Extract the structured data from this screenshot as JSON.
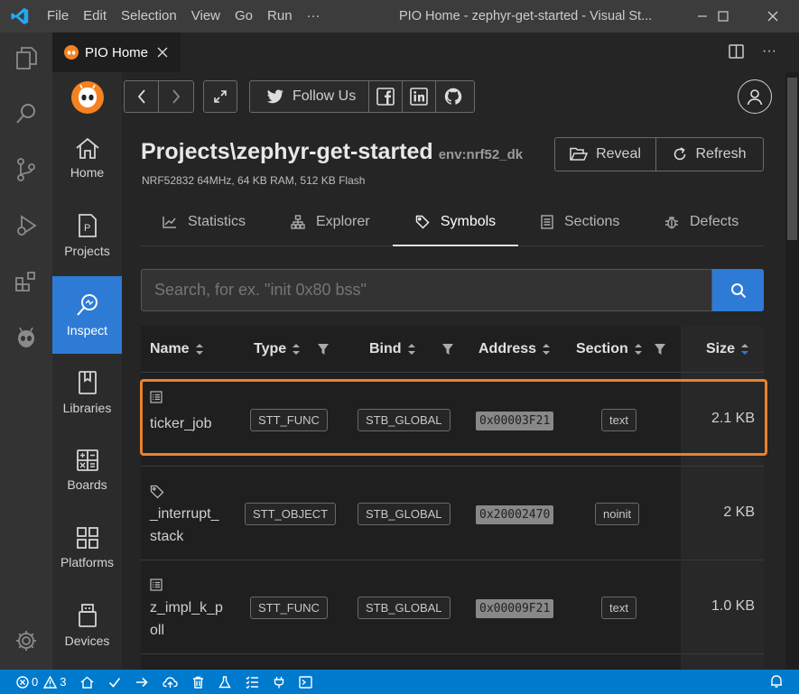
{
  "titlebar": {
    "menu": [
      "File",
      "Edit",
      "Selection",
      "View",
      "Go",
      "Run",
      "···"
    ],
    "title": "PIO Home - zephyr-get-started - Visual St..."
  },
  "tab": {
    "label": "PIO Home"
  },
  "pio_nav": [
    {
      "label": "Home",
      "icon": "home-icon"
    },
    {
      "label": "Projects",
      "icon": "projects-icon"
    },
    {
      "label": "Inspect",
      "icon": "inspect-icon",
      "active": true
    },
    {
      "label": "Libraries",
      "icon": "libraries-icon"
    },
    {
      "label": "Boards",
      "icon": "boards-icon"
    },
    {
      "label": "Platforms",
      "icon": "platforms-icon"
    },
    {
      "label": "Devices",
      "icon": "devices-icon"
    }
  ],
  "toolbar": {
    "follow_label": "Follow Us"
  },
  "project": {
    "title": "Projects\\zephyr-get-started",
    "env": "env:nrf52_dk",
    "specs": "NRF52832 64MHz, 64 KB RAM, 512 KB Flash",
    "reveal_label": "Reveal",
    "refresh_label": "Refresh"
  },
  "tabs": [
    {
      "label": "Statistics"
    },
    {
      "label": "Explorer"
    },
    {
      "label": "Symbols",
      "active": true
    },
    {
      "label": "Sections"
    },
    {
      "label": "Defects"
    }
  ],
  "search": {
    "placeholder": "Search, for ex. \"init 0x80 bss\""
  },
  "table": {
    "headers": [
      "Name",
      "Type",
      "Bind",
      "Address",
      "Section",
      "Size"
    ],
    "rows": [
      {
        "icon": "function-icon",
        "name": [
          "ticker_job"
        ],
        "type": "STT_FUNC",
        "bind": "STB_GLOBAL",
        "address": "0x00003F21",
        "section": "text",
        "size": "2.1 KB",
        "highlighted": true
      },
      {
        "icon": "tag-icon",
        "name": [
          "_interrupt_",
          "stack"
        ],
        "type": "STT_OBJECT",
        "bind": "STB_GLOBAL",
        "address": "0x20002470",
        "section": "noinit",
        "size": "2 KB"
      },
      {
        "icon": "function-icon",
        "name": [
          "z_impl_k_p",
          "oll"
        ],
        "type": "STT_FUNC",
        "bind": "STB_GLOBAL",
        "address": "0x00009F21",
        "section": "text",
        "size": "1.0 KB"
      }
    ]
  },
  "statusbar": {
    "errors": "0",
    "warnings": "3"
  },
  "colors": {
    "accent": "#2e7bd6",
    "highlight": "#e8822c",
    "statusbar": "#007acc",
    "pio_logo": "#f58220"
  }
}
